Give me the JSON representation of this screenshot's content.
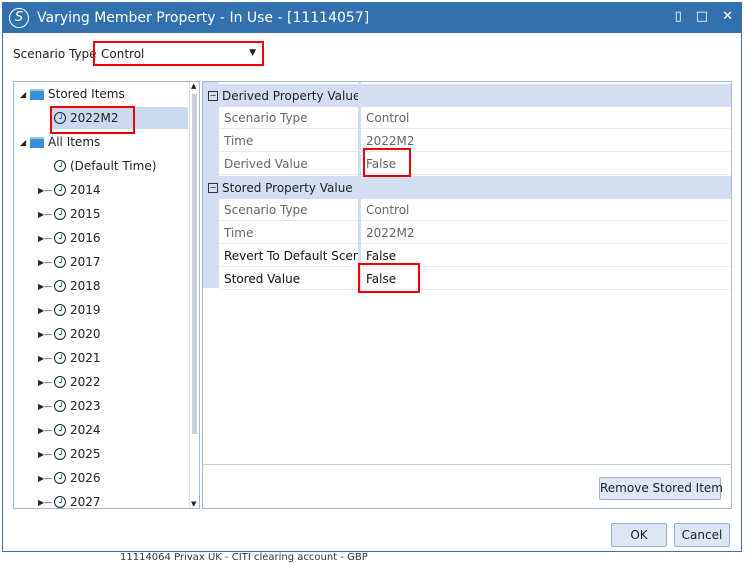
{
  "dialog": {
    "title": "Varying Member Property - In Use - [11114057]"
  },
  "scenario": {
    "label": "Scenario Type",
    "value": "Control"
  },
  "tree": {
    "stored_items": "Stored Items",
    "stored_child": "2022M2",
    "all_items": "All Items",
    "default_time": "(Default Time)",
    "years": [
      "2014",
      "2015",
      "2016",
      "2017",
      "2018",
      "2019",
      "2020",
      "2021",
      "2022",
      "2023",
      "2024",
      "2025",
      "2026",
      "2027"
    ]
  },
  "grid": {
    "derived": {
      "header": "Derived Property Value",
      "rows": [
        {
          "name": "Scenario Type",
          "value": "Control"
        },
        {
          "name": "Time",
          "value": "2022M2"
        },
        {
          "name": "Derived Value",
          "value": "False"
        }
      ]
    },
    "stored": {
      "header": "Stored Property Value",
      "rows": [
        {
          "name": "Scenario Type",
          "value": "Control"
        },
        {
          "name": "Time",
          "value": "2022M2"
        },
        {
          "name": "Revert To Default Scenario",
          "value": "False"
        },
        {
          "name": "Stored Value",
          "value": "False"
        }
      ]
    },
    "remove_button": "Remove Stored Item"
  },
  "buttons": {
    "ok": "OK",
    "cancel": "Cancel"
  },
  "background": {
    "row_text": "11114064   Privax UK - CITI clearing account - GBP"
  },
  "colors": {
    "titlebar": "#3270ae",
    "highlight": "#e00000",
    "header": "#d3def3"
  }
}
